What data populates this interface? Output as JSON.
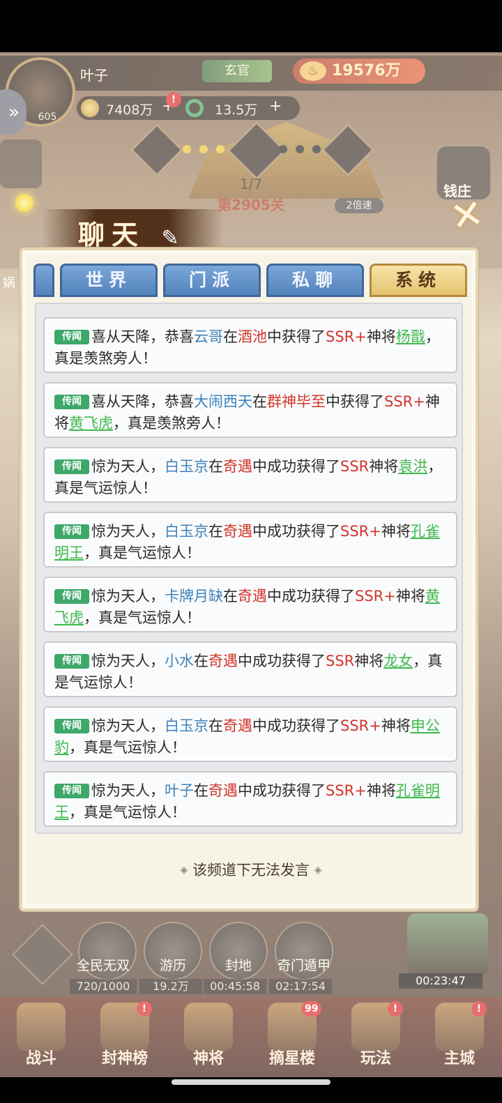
{
  "player": {
    "name": "叶子",
    "level": "605",
    "rank": "玄官",
    "power": "19576万",
    "power_icon": "gourd-icon"
  },
  "resources": {
    "gold": "7408万",
    "jade": "13.5万",
    "plus": "+",
    "alert": "!"
  },
  "stage": {
    "progress": "1/7",
    "level": "第2905关",
    "speed": "2倍速"
  },
  "bank": {
    "label": "钱庄"
  },
  "left_feature": {
    "label": "娲"
  },
  "dialog": {
    "title": "聊天",
    "close_icon": "close-icon",
    "tabs": [
      {
        "label": "世界",
        "active": false
      },
      {
        "label": "门派",
        "active": false
      },
      {
        "label": "私聊",
        "active": false
      },
      {
        "label": "系统",
        "active": true
      }
    ],
    "tag_label": "传闻",
    "messages": [
      {
        "intro": "喜从天降，恭喜",
        "player": "云哥",
        "at": "在",
        "place": "酒池",
        "verb": "中获得了",
        "rarity": "SSR+",
        "hero_prefix": "神将",
        "hero": "杨戬",
        "outro": "，真是羡煞旁人！"
      },
      {
        "intro": "喜从天降，恭喜",
        "player": "大闹西天",
        "at": "在",
        "place": "群神毕至",
        "verb": "中获得了",
        "rarity": "SSR+",
        "hero_prefix": "神将",
        "hero": "黄飞虎",
        "outro": "，真是羡煞旁人！"
      },
      {
        "intro": "惊为天人，",
        "player": "白玉京",
        "at": "在",
        "place": "奇遇",
        "verb": "中成功获得了",
        "rarity": "SSR",
        "hero_prefix": "神将",
        "hero": "袁洪",
        "outro": "，真是气运惊人！"
      },
      {
        "intro": "惊为天人，",
        "player": "白玉京",
        "at": "在",
        "place": "奇遇",
        "verb": "中成功获得了",
        "rarity": "SSR+",
        "hero_prefix": "神将",
        "hero": "孔雀明王",
        "outro": "，真是气运惊人！"
      },
      {
        "intro": "惊为天人，",
        "player": "卡牌月缺",
        "at": "在",
        "place": "奇遇",
        "verb": "中成功获得了",
        "rarity": "SSR+",
        "hero_prefix": "神将",
        "hero": "黄飞虎",
        "outro": "，真是气运惊人！"
      },
      {
        "intro": "惊为天人，",
        "player": "小水",
        "at": "在",
        "place": "奇遇",
        "verb": "中成功获得了",
        "rarity": "SSR",
        "hero_prefix": "神将",
        "hero": "龙女",
        "outro": "，真是气运惊人！"
      },
      {
        "intro": "惊为天人，",
        "player": "白玉京",
        "at": "在",
        "place": "奇遇",
        "verb": "中成功获得了",
        "rarity": "SSR+",
        "hero_prefix": "神将",
        "hero": "申公豹",
        "outro": "，真是气运惊人！"
      },
      {
        "intro": "惊为天人，",
        "player": "叶子",
        "at": "在",
        "place": "奇遇",
        "verb": "中成功获得了",
        "rarity": "SSR+",
        "hero_prefix": "神将",
        "hero": "孔雀明王",
        "outro": "，真是气运惊人！"
      }
    ],
    "no_speak": "该频道下无法发言",
    "colors": {
      "player_name": "#3f82b9",
      "place": "#d4352b",
      "hero_link": "#40b84d",
      "tag_bg": "#3da86a",
      "active_tab": "#e3c26e",
      "tab": "#5484bd"
    }
  },
  "features": [
    {
      "label": "全民无双",
      "value": "720/1000"
    },
    {
      "label": "游历",
      "value": "19.2万"
    },
    {
      "label": "封地",
      "value": "00:45:58"
    },
    {
      "label": "奇门遁甲",
      "value": "02:17:54"
    }
  ],
  "chest_timer": "00:23:47",
  "nav": [
    {
      "label": "战斗",
      "badge": ""
    },
    {
      "label": "封神榜",
      "badge": "!"
    },
    {
      "label": "神将",
      "badge": ""
    },
    {
      "label": "摘星楼",
      "badge": "99"
    },
    {
      "label": "玩法",
      "badge": "!"
    },
    {
      "label": "主城",
      "badge": "!"
    }
  ]
}
